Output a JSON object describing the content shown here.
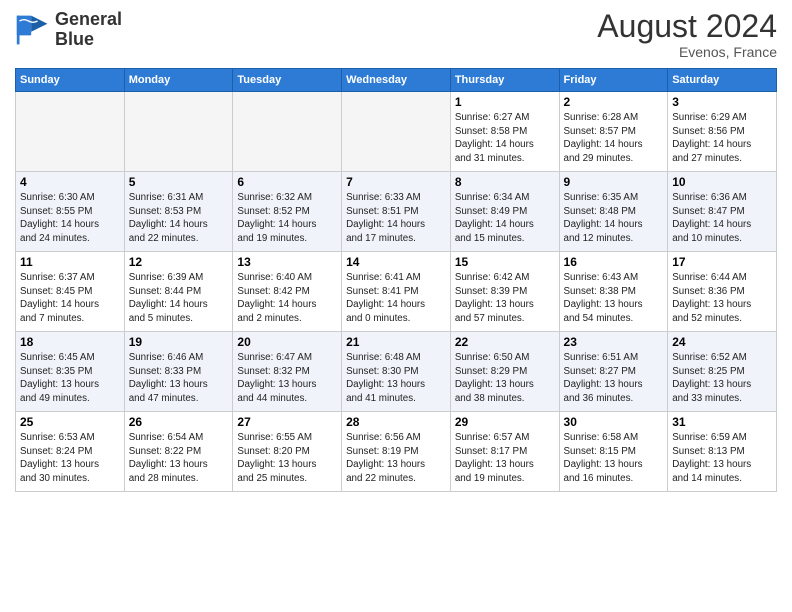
{
  "header": {
    "logo_line1": "General",
    "logo_line2": "Blue",
    "month_title": "August 2024",
    "location": "Evenos, France"
  },
  "days_of_week": [
    "Sunday",
    "Monday",
    "Tuesday",
    "Wednesday",
    "Thursday",
    "Friday",
    "Saturday"
  ],
  "weeks": [
    [
      {
        "day": "",
        "info": ""
      },
      {
        "day": "",
        "info": ""
      },
      {
        "day": "",
        "info": ""
      },
      {
        "day": "",
        "info": ""
      },
      {
        "day": "1",
        "info": "Sunrise: 6:27 AM\nSunset: 8:58 PM\nDaylight: 14 hours\nand 31 minutes."
      },
      {
        "day": "2",
        "info": "Sunrise: 6:28 AM\nSunset: 8:57 PM\nDaylight: 14 hours\nand 29 minutes."
      },
      {
        "day": "3",
        "info": "Sunrise: 6:29 AM\nSunset: 8:56 PM\nDaylight: 14 hours\nand 27 minutes."
      }
    ],
    [
      {
        "day": "4",
        "info": "Sunrise: 6:30 AM\nSunset: 8:55 PM\nDaylight: 14 hours\nand 24 minutes."
      },
      {
        "day": "5",
        "info": "Sunrise: 6:31 AM\nSunset: 8:53 PM\nDaylight: 14 hours\nand 22 minutes."
      },
      {
        "day": "6",
        "info": "Sunrise: 6:32 AM\nSunset: 8:52 PM\nDaylight: 14 hours\nand 19 minutes."
      },
      {
        "day": "7",
        "info": "Sunrise: 6:33 AM\nSunset: 8:51 PM\nDaylight: 14 hours\nand 17 minutes."
      },
      {
        "day": "8",
        "info": "Sunrise: 6:34 AM\nSunset: 8:49 PM\nDaylight: 14 hours\nand 15 minutes."
      },
      {
        "day": "9",
        "info": "Sunrise: 6:35 AM\nSunset: 8:48 PM\nDaylight: 14 hours\nand 12 minutes."
      },
      {
        "day": "10",
        "info": "Sunrise: 6:36 AM\nSunset: 8:47 PM\nDaylight: 14 hours\nand 10 minutes."
      }
    ],
    [
      {
        "day": "11",
        "info": "Sunrise: 6:37 AM\nSunset: 8:45 PM\nDaylight: 14 hours\nand 7 minutes."
      },
      {
        "day": "12",
        "info": "Sunrise: 6:39 AM\nSunset: 8:44 PM\nDaylight: 14 hours\nand 5 minutes."
      },
      {
        "day": "13",
        "info": "Sunrise: 6:40 AM\nSunset: 8:42 PM\nDaylight: 14 hours\nand 2 minutes."
      },
      {
        "day": "14",
        "info": "Sunrise: 6:41 AM\nSunset: 8:41 PM\nDaylight: 14 hours\nand 0 minutes."
      },
      {
        "day": "15",
        "info": "Sunrise: 6:42 AM\nSunset: 8:39 PM\nDaylight: 13 hours\nand 57 minutes."
      },
      {
        "day": "16",
        "info": "Sunrise: 6:43 AM\nSunset: 8:38 PM\nDaylight: 13 hours\nand 54 minutes."
      },
      {
        "day": "17",
        "info": "Sunrise: 6:44 AM\nSunset: 8:36 PM\nDaylight: 13 hours\nand 52 minutes."
      }
    ],
    [
      {
        "day": "18",
        "info": "Sunrise: 6:45 AM\nSunset: 8:35 PM\nDaylight: 13 hours\nand 49 minutes."
      },
      {
        "day": "19",
        "info": "Sunrise: 6:46 AM\nSunset: 8:33 PM\nDaylight: 13 hours\nand 47 minutes."
      },
      {
        "day": "20",
        "info": "Sunrise: 6:47 AM\nSunset: 8:32 PM\nDaylight: 13 hours\nand 44 minutes."
      },
      {
        "day": "21",
        "info": "Sunrise: 6:48 AM\nSunset: 8:30 PM\nDaylight: 13 hours\nand 41 minutes."
      },
      {
        "day": "22",
        "info": "Sunrise: 6:50 AM\nSunset: 8:29 PM\nDaylight: 13 hours\nand 38 minutes."
      },
      {
        "day": "23",
        "info": "Sunrise: 6:51 AM\nSunset: 8:27 PM\nDaylight: 13 hours\nand 36 minutes."
      },
      {
        "day": "24",
        "info": "Sunrise: 6:52 AM\nSunset: 8:25 PM\nDaylight: 13 hours\nand 33 minutes."
      }
    ],
    [
      {
        "day": "25",
        "info": "Sunrise: 6:53 AM\nSunset: 8:24 PM\nDaylight: 13 hours\nand 30 minutes."
      },
      {
        "day": "26",
        "info": "Sunrise: 6:54 AM\nSunset: 8:22 PM\nDaylight: 13 hours\nand 28 minutes."
      },
      {
        "day": "27",
        "info": "Sunrise: 6:55 AM\nSunset: 8:20 PM\nDaylight: 13 hours\nand 25 minutes."
      },
      {
        "day": "28",
        "info": "Sunrise: 6:56 AM\nSunset: 8:19 PM\nDaylight: 13 hours\nand 22 minutes."
      },
      {
        "day": "29",
        "info": "Sunrise: 6:57 AM\nSunset: 8:17 PM\nDaylight: 13 hours\nand 19 minutes."
      },
      {
        "day": "30",
        "info": "Sunrise: 6:58 AM\nSunset: 8:15 PM\nDaylight: 13 hours\nand 16 minutes."
      },
      {
        "day": "31",
        "info": "Sunrise: 6:59 AM\nSunset: 8:13 PM\nDaylight: 13 hours\nand 14 minutes."
      }
    ]
  ]
}
